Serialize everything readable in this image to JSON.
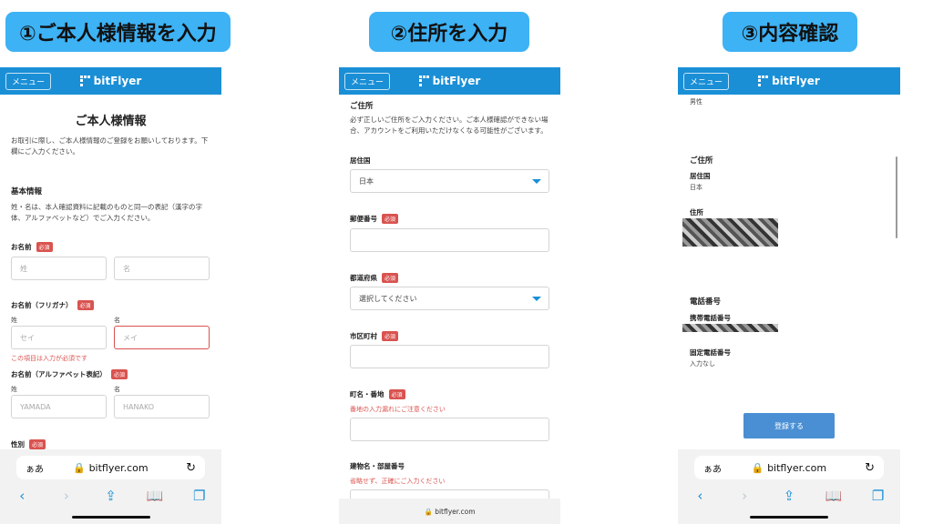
{
  "steps": {
    "step1": "①ご本人様情報を入力",
    "step2": "②住所を入力",
    "step3": "③内容確認"
  },
  "appbar": {
    "menu_label": "メニュー",
    "logo_text": "bitFlyer"
  },
  "screen1": {
    "title": "ご本人様情報",
    "intro": "お取引に際し、ご本人様情報のご登録をお願いしております。下欄にご入力ください。",
    "section_title": "基本情報",
    "section_note": "姓・名は、本人確認資料に記載のものと同一の表記（漢字の字体、アルファベットなど）でご入力ください。",
    "name_label": "お名前",
    "required": "必須",
    "last_placeholder": "姓",
    "first_placeholder": "名",
    "furigana_label": "お名前（フリガナ）",
    "sub_last": "姓",
    "sub_first": "名",
    "kana_last_placeholder": "セイ",
    "kana_first_placeholder": "メイ",
    "error_required": "この項目は入力が必須です",
    "alpha_label": "お名前（アルファベット表記）",
    "alpha_last_placeholder": "YAMADA",
    "alpha_first_placeholder": "HANAKO",
    "gender_label": "性別"
  },
  "screen2": {
    "section_title": "ご住所",
    "intro": "必ず正しいご住所をご入力ください。ご本人様確認ができない場合、アカウントをご利用いただけなくなる可能性がございます。",
    "country_label": "居住国",
    "country_value": "日本",
    "postal_label": "郵便番号",
    "prefecture_label": "都道府県",
    "prefecture_value": "選択してください",
    "city_label": "市区町村",
    "street_label": "町名・番地",
    "street_note": "番地の入力漏れにご注意ください",
    "building_label": "建物名・部屋番号",
    "building_note": "省略せず、正確にご入力ください",
    "required": "必須",
    "url": "bitflyer.com"
  },
  "screen3": {
    "gender_value": "男性",
    "address_section": "ご住所",
    "country_label": "居住国",
    "country_value": "日本",
    "address_label": "住所",
    "phone_section": "電話番号",
    "mobile_label": "携帯電話番号",
    "landline_label": "固定電話番号",
    "landline_value": "入力なし",
    "register_button": "登録する"
  },
  "safari": {
    "aa": "ぁあ",
    "url": "bitflyer.com",
    "lock_icon": "lock-icon",
    "reload_icon": "reload-icon"
  }
}
